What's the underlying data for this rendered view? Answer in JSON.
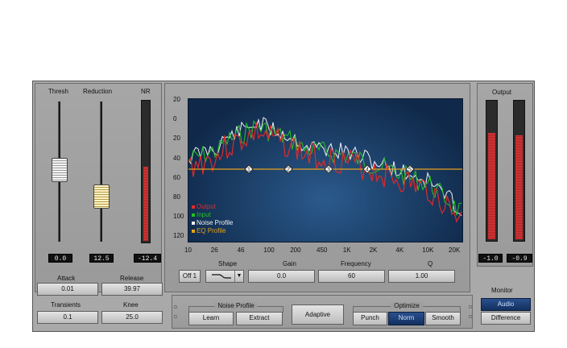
{
  "dynamics": {
    "labels": {
      "thresh": "Thresh",
      "reduction": "Reduction",
      "nr": "NR"
    },
    "readouts": {
      "thresh": "0.0",
      "reduction": "12.5",
      "nr": "-12.4"
    },
    "attack": {
      "label": "Attack",
      "value": "0.01"
    },
    "release": {
      "label": "Release",
      "value": "39.97"
    },
    "transients": {
      "label": "Transients",
      "value": "0.1"
    },
    "knee": {
      "label": "Knee",
      "value": "25.0"
    },
    "nr_meter_level": 0.52
  },
  "graph": {
    "y_ticks": [
      "20",
      "0",
      "20",
      "40",
      "60",
      "80",
      "100",
      "120"
    ],
    "x_ticks": [
      "10",
      "26",
      "46",
      "100",
      "200",
      "450",
      "1K",
      "2K",
      "4K",
      "10K",
      "20K"
    ],
    "legend": [
      {
        "label": "Output",
        "color": "#e02a2a"
      },
      {
        "label": "Input",
        "color": "#22c322"
      },
      {
        "label": "Noise Profile",
        "color": "#f2f2f2"
      },
      {
        "label": "EQ Profile",
        "color": "#e8a21a"
      }
    ],
    "eq_nodes": [
      "1",
      "2",
      "3",
      "4",
      "5"
    ],
    "colors": {
      "bg_top": "#1a4a7a",
      "bg_bottom": "#0d2240"
    }
  },
  "controls": {
    "shape": {
      "label": "Shape"
    },
    "gain": {
      "label": "Gain",
      "value": "0.0"
    },
    "frequency": {
      "label": "Frequency",
      "value": "60"
    },
    "q": {
      "label": "Q",
      "value": "1.00"
    },
    "band_toggle": "Off 1"
  },
  "noise_profile": {
    "title": "Noise Profile",
    "learn": "Learn",
    "extract": "Extract"
  },
  "adaptive": "Adaptive",
  "optimize": {
    "title": "Optimize",
    "options": [
      "Punch",
      "Norm",
      "Smooth"
    ],
    "selected": "Norm"
  },
  "output": {
    "label": "Output",
    "readouts": {
      "left": "-1.0",
      "right": "-0.9"
    },
    "levels": {
      "left": 0.76,
      "right": 0.74
    }
  },
  "monitor": {
    "label": "Monitor",
    "options": [
      "Audio",
      "Difference"
    ],
    "selected": "Audio"
  }
}
